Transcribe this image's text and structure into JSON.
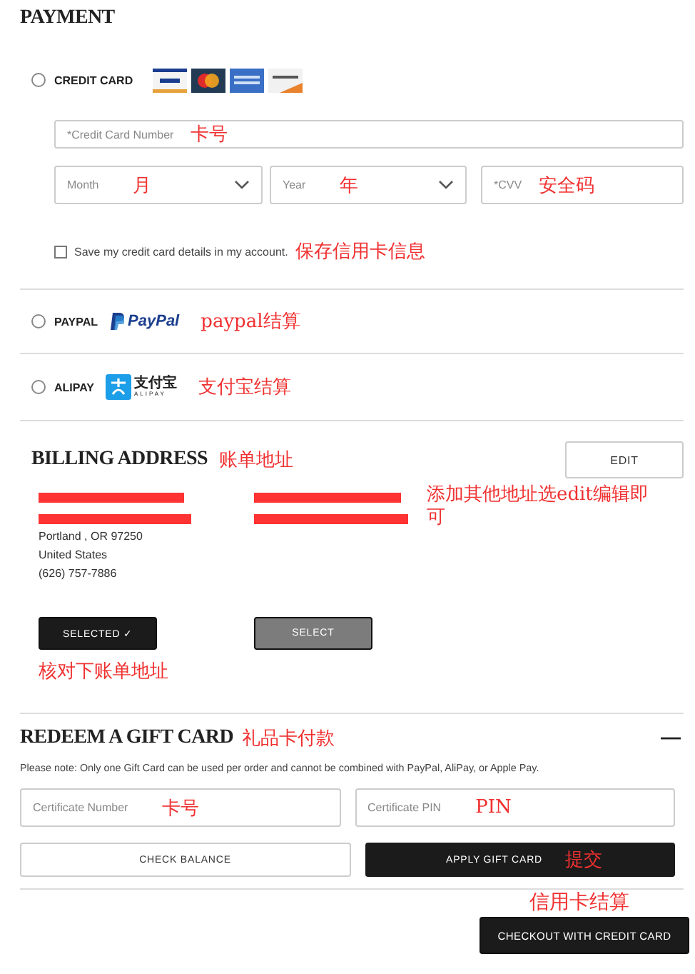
{
  "payment": {
    "title": "PAYMENT",
    "methods": [
      {
        "kind": "card",
        "label": "CREDIT CARD",
        "selected": false
      },
      {
        "kind": "paypal",
        "label": "PAYPAL",
        "logo_text": "PayPal",
        "note": "paypal结算",
        "selected": false
      },
      {
        "kind": "alipay",
        "label": "ALIPAY",
        "logo_text": "支付宝",
        "logo_subtext": "ALIPAY",
        "note": "支付宝结算",
        "selected": false
      }
    ],
    "card_number": {
      "placeholder": "*Credit Card Number",
      "note": "卡号"
    },
    "month": {
      "placeholder": "Month",
      "note": "月"
    },
    "year": {
      "placeholder": "Year",
      "note": "年"
    },
    "cvv": {
      "placeholder": "*CVV",
      "note": "安全码"
    },
    "save_card": {
      "label": "Save my credit card details in my account.",
      "checked": false,
      "note": "保存信用卡信息"
    }
  },
  "billing": {
    "title": "BILLING ADDRESS",
    "note": "账单地址",
    "edit": "EDIT",
    "edit_note": "添加其他地址选edit编辑即可",
    "addresses": [
      {
        "lines": [
          "Portland , OR 97250",
          "United States",
          "(626) 757-7886"
        ],
        "button": "SELECTED ✓",
        "selected": true
      },
      {
        "button": "SELECT",
        "selected": false
      }
    ],
    "select_note": "核对下账单地址"
  },
  "gift_card": {
    "title": "REDEEM A GIFT CARD",
    "note": "礼品卡付款",
    "expanded": true,
    "notice": "Please note: Only one Gift Card can be used per order and cannot be combined with PayPal, AliPay, or Apple Pay.",
    "number": {
      "placeholder": "Certificate Number",
      "note": "卡号"
    },
    "pin": {
      "placeholder": "Certificate PIN",
      "note": "PIN"
    },
    "check_balance": "CHECK BALANCE",
    "apply": "APPLY GIFT CARD",
    "apply_note": "提交"
  },
  "checkout": {
    "note": "信用卡结算",
    "button": "CHECKOUT WITH CREDIT CARD"
  }
}
